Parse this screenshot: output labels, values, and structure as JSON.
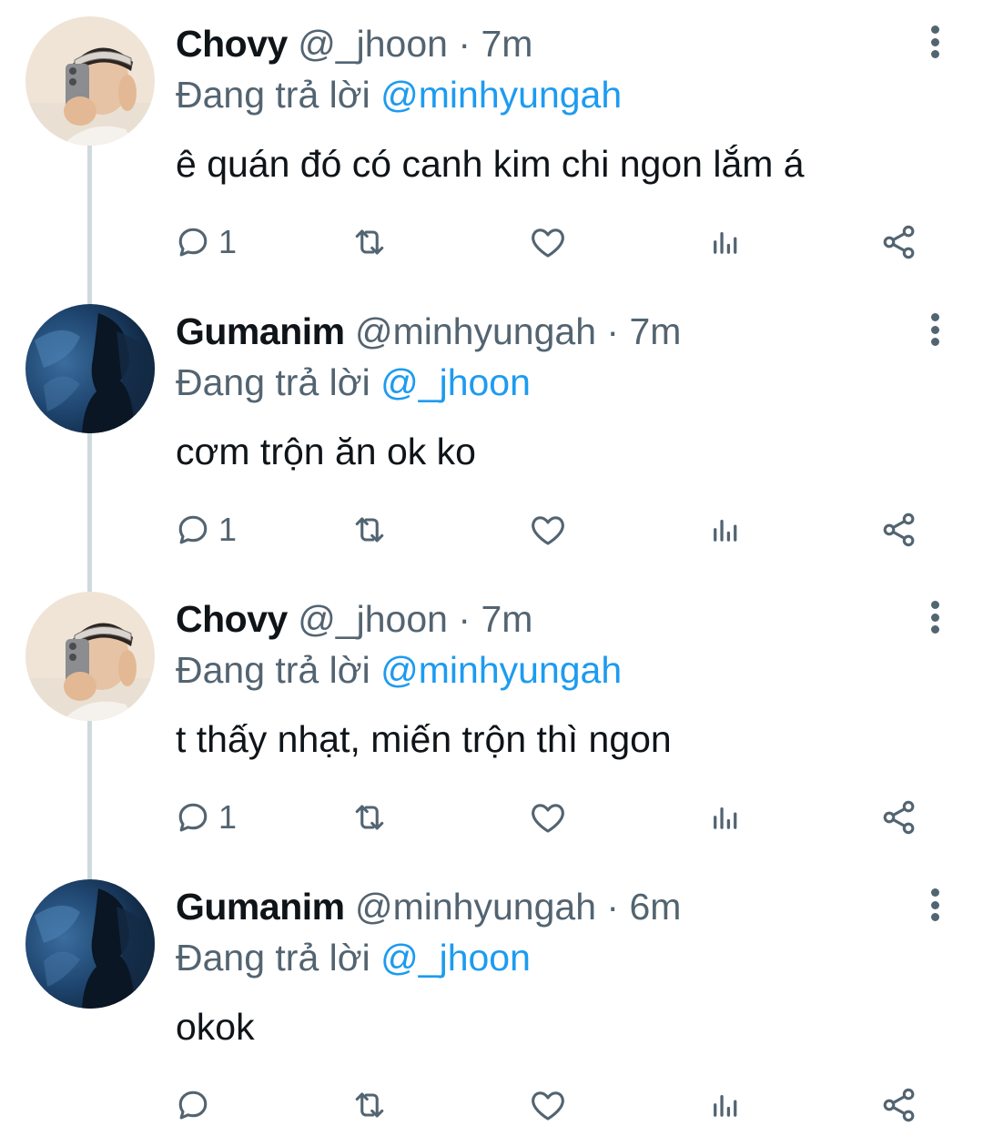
{
  "reply_prefix": "Đang trả lời",
  "tweets": [
    {
      "display_name": "Chovy",
      "handle": "@_jhoon",
      "separator": "·",
      "time": "7m",
      "reply_to": "@minhyungah",
      "text": "ê quán đó có canh kim chi ngon lắm á",
      "reply_count": "1",
      "avatar": "selfie-avatar"
    },
    {
      "display_name": "Gumanim",
      "handle": "@minhyungah",
      "separator": "·",
      "time": "7m",
      "reply_to": "@_jhoon",
      "text": "cơm trộn ăn ok ko",
      "reply_count": "1",
      "avatar": "dark-blue-avatar"
    },
    {
      "display_name": "Chovy",
      "handle": "@_jhoon",
      "separator": "·",
      "time": "7m",
      "reply_to": "@minhyungah",
      "text": "t thấy nhạt, miến trộn thì ngon",
      "reply_count": "1",
      "avatar": "selfie-avatar"
    },
    {
      "display_name": "Gumanim",
      "handle": "@minhyungah",
      "separator": "·",
      "time": "6m",
      "reply_to": "@_jhoon",
      "text": "okok",
      "reply_count": "",
      "avatar": "dark-blue-avatar"
    }
  ],
  "icons": {
    "reply": "comment-icon",
    "retweet": "retweet-icon",
    "like": "heart-icon",
    "views": "analytics-icon",
    "share": "share-icon",
    "more": "more-vertical-icon"
  },
  "colors": {
    "text": "#0f1419",
    "secondary": "#536471",
    "link": "#1d9bf0",
    "thread_line": "#cfd9de"
  }
}
